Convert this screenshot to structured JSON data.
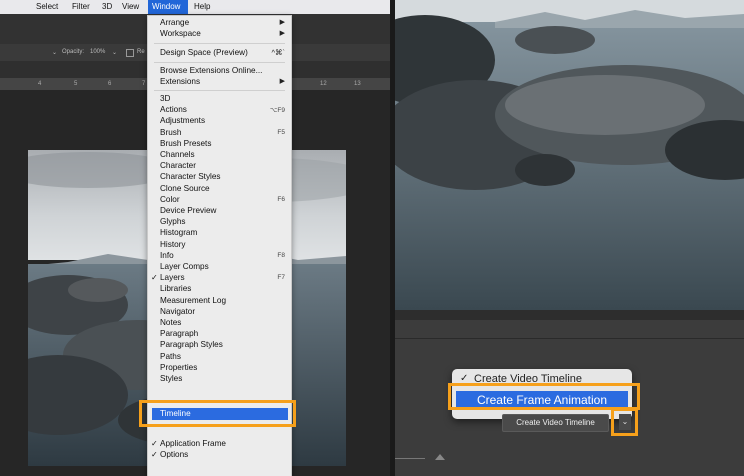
{
  "menubar": {
    "items": [
      "Select",
      "Filter",
      "3D",
      "View",
      "Window",
      "Help"
    ]
  },
  "options_bar": {
    "opacity_label": "Opacity:",
    "opacity_value": "100%",
    "re_label": "Re"
  },
  "ruler": {
    "ticks": [
      "4",
      "5",
      "6",
      "7",
      "12",
      "13"
    ]
  },
  "window_menu": {
    "arrange": "Arrange",
    "workspace": "Workspace",
    "design_space": "Design Space (Preview)",
    "design_space_shortcut": "^⌘`",
    "browse_ext": "Browse Extensions Online...",
    "extensions": "Extensions",
    "panels": [
      {
        "label": "3D",
        "shortcut": ""
      },
      {
        "label": "Actions",
        "shortcut": "⌥F9"
      },
      {
        "label": "Adjustments",
        "shortcut": ""
      },
      {
        "label": "Brush",
        "shortcut": "F5"
      },
      {
        "label": "Brush Presets",
        "shortcut": ""
      },
      {
        "label": "Channels",
        "shortcut": ""
      },
      {
        "label": "Character",
        "shortcut": ""
      },
      {
        "label": "Character Styles",
        "shortcut": ""
      },
      {
        "label": "Clone Source",
        "shortcut": ""
      },
      {
        "label": "Color",
        "shortcut": "F6"
      },
      {
        "label": "Device Preview",
        "shortcut": ""
      },
      {
        "label": "Glyphs",
        "shortcut": ""
      },
      {
        "label": "Histogram",
        "shortcut": ""
      },
      {
        "label": "History",
        "shortcut": ""
      },
      {
        "label": "Info",
        "shortcut": "F8"
      },
      {
        "label": "Layer Comps",
        "shortcut": ""
      },
      {
        "label": "Layers",
        "shortcut": "F7"
      },
      {
        "label": "Libraries",
        "shortcut": ""
      },
      {
        "label": "Measurement Log",
        "shortcut": ""
      },
      {
        "label": "Navigator",
        "shortcut": ""
      },
      {
        "label": "Notes",
        "shortcut": ""
      },
      {
        "label": "Paragraph",
        "shortcut": ""
      },
      {
        "label": "Paragraph Styles",
        "shortcut": ""
      },
      {
        "label": "Paths",
        "shortcut": ""
      },
      {
        "label": "Properties",
        "shortcut": ""
      },
      {
        "label": "Styles",
        "shortcut": ""
      }
    ],
    "timeline": "Timeline",
    "application_frame": "Application Frame",
    "options": "Options"
  },
  "timeline_popup": {
    "create_video_timeline": "Create Video Timeline",
    "create_frame_animation": "Create Frame Animation"
  },
  "timeline_panel": {
    "button_label": "Create Video Timeline",
    "dropdown_arrow": "⌄"
  },
  "colors": {
    "highlight": "#f6a01b",
    "selection": "#2b6be0"
  }
}
